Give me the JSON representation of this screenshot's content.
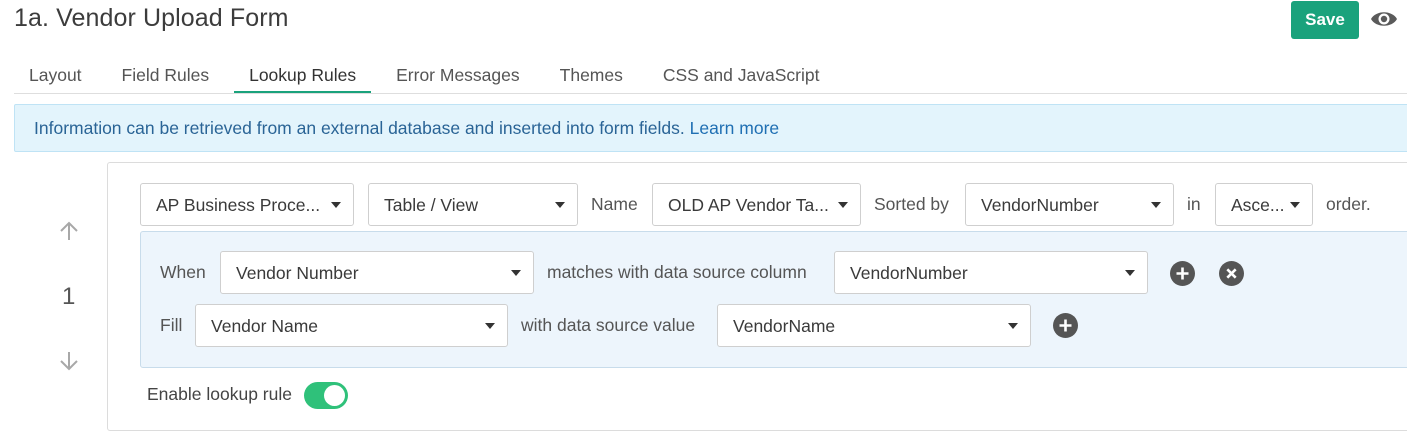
{
  "page": {
    "title": "1a. Vendor Upload Form"
  },
  "toolbar": {
    "save_label": "Save",
    "preview_icon": "eye-icon"
  },
  "tabs": [
    {
      "label": "Layout",
      "active": false
    },
    {
      "label": "Field Rules",
      "active": false
    },
    {
      "label": "Lookup Rules",
      "active": true
    },
    {
      "label": "Error Messages",
      "active": false
    },
    {
      "label": "Themes",
      "active": false
    },
    {
      "label": "CSS and JavaScript",
      "active": false
    }
  ],
  "info": {
    "text": "Information can be retrieved from an external database and inserted into form fields.",
    "link": "Learn more"
  },
  "rule": {
    "number": "1",
    "source": {
      "datasource": "AP Business Proce...",
      "object_type": "Table / View",
      "name_label": "Name",
      "name_value": "OLD AP Vendor Ta...",
      "sorted_label": "Sorted by",
      "sorted_value": "VendorNumber",
      "in_label": "in",
      "order_value": "Asce...",
      "order_label": "order."
    },
    "when": {
      "label": "When",
      "field": "Vendor Number",
      "matches_label": "matches with data source column",
      "column": "VendorNumber"
    },
    "fill": {
      "label": "Fill",
      "field": "Vendor Name",
      "value_label": "with data source value",
      "value": "VendorName"
    },
    "enable_label": "Enable lookup rule",
    "enabled": true
  },
  "colors": {
    "accent": "#1aa27c",
    "toggle_on": "#2fc17a",
    "banner_bg": "#e3f4fc",
    "condition_bg": "#edf5fc"
  }
}
